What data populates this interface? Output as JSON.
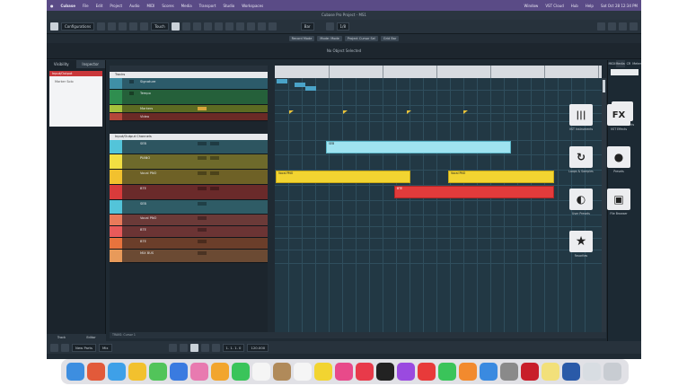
{
  "menubar": {
    "app": "Cubase",
    "items": [
      "File",
      "Edit",
      "Project",
      "Audio",
      "MIDI",
      "Scores",
      "Media",
      "Transport",
      "Studio",
      "Workspaces"
    ],
    "right_items": [
      "Window",
      "VST Cloud",
      "Hub",
      "Help"
    ],
    "clock": "Sat Oct 28 12:34 PM"
  },
  "window": {
    "title": "Cubase Pro Project - MS1"
  },
  "toolbar": {
    "configurations": "Configurations",
    "touch_mode": "Touch",
    "grid": "Bar",
    "quantize": "1/8"
  },
  "subbar": {
    "buttons": [
      "Record Mode",
      "Mode: Mode",
      "Project Cursor Sel",
      "Grid Bar"
    ]
  },
  "info": {
    "text": "No Object Selected"
  },
  "inspector": {
    "tabs": [
      "Visibility",
      "Inspector"
    ],
    "track_name": "Input/Output",
    "box_text": "Marker Solo",
    "bottom_tabs": [
      "Track",
      "Editor"
    ]
  },
  "tracks": [
    {
      "name": "Signature",
      "color": "#3f8fa6"
    },
    {
      "name": "Tempo",
      "color": "#2f8e4f"
    },
    {
      "name": "Markers",
      "color": "#a7c13c"
    },
    {
      "name": "Video",
      "color": "#b5473a"
    },
    {
      "name": "SEB",
      "color": "#53c4d9"
    },
    {
      "name": "PIANO",
      "color": "#f2df42"
    },
    {
      "name": "Vocal PNO",
      "color": "#f2c12e"
    },
    {
      "name": "BTE",
      "color": "#d93b3b"
    },
    {
      "name": "SEB",
      "color": "#53c4d9"
    },
    {
      "name": "Vocal PNO",
      "color": "#e87a5a"
    },
    {
      "name": "BTE",
      "color": "#e85a5a"
    },
    {
      "name": "BTE",
      "color": "#e8733d"
    },
    {
      "name": "MIX BUS",
      "color": "#e89a5a"
    }
  ],
  "folders": {
    "tracks": "Tracks",
    "io": "Input/Output Channels"
  },
  "events": {
    "seb": "SEB",
    "vocal": "Vocal PNO",
    "bte": "BTE"
  },
  "colors": {
    "cyan": "#9fe3f0",
    "yellow": "#f2d431",
    "red": "#e23b3b",
    "accent": "#5a4b86"
  },
  "rightzone": {
    "tabs": [
      "MIDI",
      "Media",
      "CR",
      "Meter"
    ],
    "items": [
      {
        "label": "VST Instruments",
        "icon": "piano-keys-icon",
        "glyph": "|||"
      },
      {
        "label": "VST Effects",
        "icon": "fx-icon",
        "glyph": "FX"
      },
      {
        "label": "Loops & Samples",
        "icon": "loop-icon",
        "glyph": "↻"
      },
      {
        "label": "Presets",
        "icon": "presets-icon",
        "glyph": "●"
      },
      {
        "label": "User Presets",
        "icon": "user-presets-icon",
        "glyph": "◐"
      },
      {
        "label": "File Browser",
        "icon": "file-browser-icon",
        "glyph": "▣"
      },
      {
        "label": "Favorites",
        "icon": "star-icon",
        "glyph": "★"
      }
    ]
  },
  "hscroll": {
    "label": "TRAKS: Cursor 1"
  },
  "statusbar": {
    "new_parts": "New Parts",
    "mix": "Mix",
    "position": "1. 1. 1. 0",
    "tempo": "120.000"
  }
}
